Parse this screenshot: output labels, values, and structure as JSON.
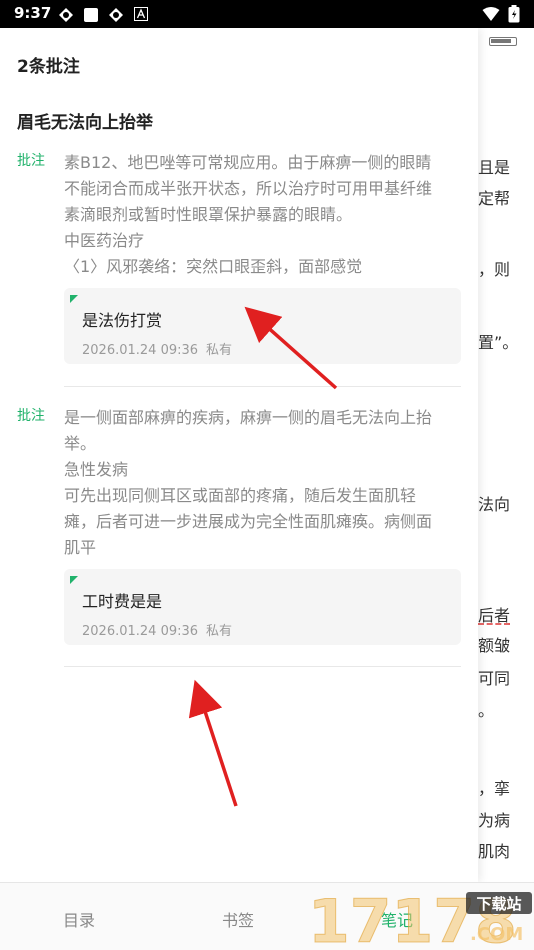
{
  "status_bar": {
    "time": "9:37"
  },
  "panel": {
    "count_label": "2条批注",
    "chapter_title": "眉毛无法向上抬举"
  },
  "notes": [
    {
      "tag": "批注",
      "excerpt": [
        "素B12、地巴唑等可常规应用。由于麻痹一侧的眼睛",
        "不能闭合而成半张开状态，所以治疗时可用甲基纤维",
        "素滴眼剂或暂时性眼罩保护暴露的眼睛。",
        "中医药治疗",
        "〈1〉风邪袭络：突然口眼歪斜，面部感觉"
      ],
      "comment": "是法伤打赏",
      "date": "2026.01.24 09:36",
      "privacy": "私有"
    },
    {
      "tag": "批注",
      "excerpt": [
        "是一侧面部麻痹的疾病，麻痹一侧的眉毛无法向上抬",
        "举。",
        "急性发病",
        "可先出现同侧耳区或面部的疼痛，随后发生面肌轻",
        "瘫，后者可进一步进展成为完全性面肌瘫痪。病侧面",
        "肌平"
      ],
      "comment": "工时费是是",
      "date": "2026.01.24 09:36",
      "privacy": "私有"
    }
  ],
  "background_fragments": [
    "且是",
    "定帮",
    "，则",
    "置”。",
    "法向",
    "后者",
    "额皱",
    "可同",
    "。",
    "，挛",
    "为病",
    "肌肉"
  ],
  "bottom_bar": {
    "toc": "目录",
    "bookmark": "书签",
    "notes": "笔记"
  },
  "watermark": {
    "brand": "17178",
    "sub": "下载站",
    "domain": ".COM"
  },
  "colors": {
    "accent": "#21b26b",
    "arrow": "#e02020"
  }
}
